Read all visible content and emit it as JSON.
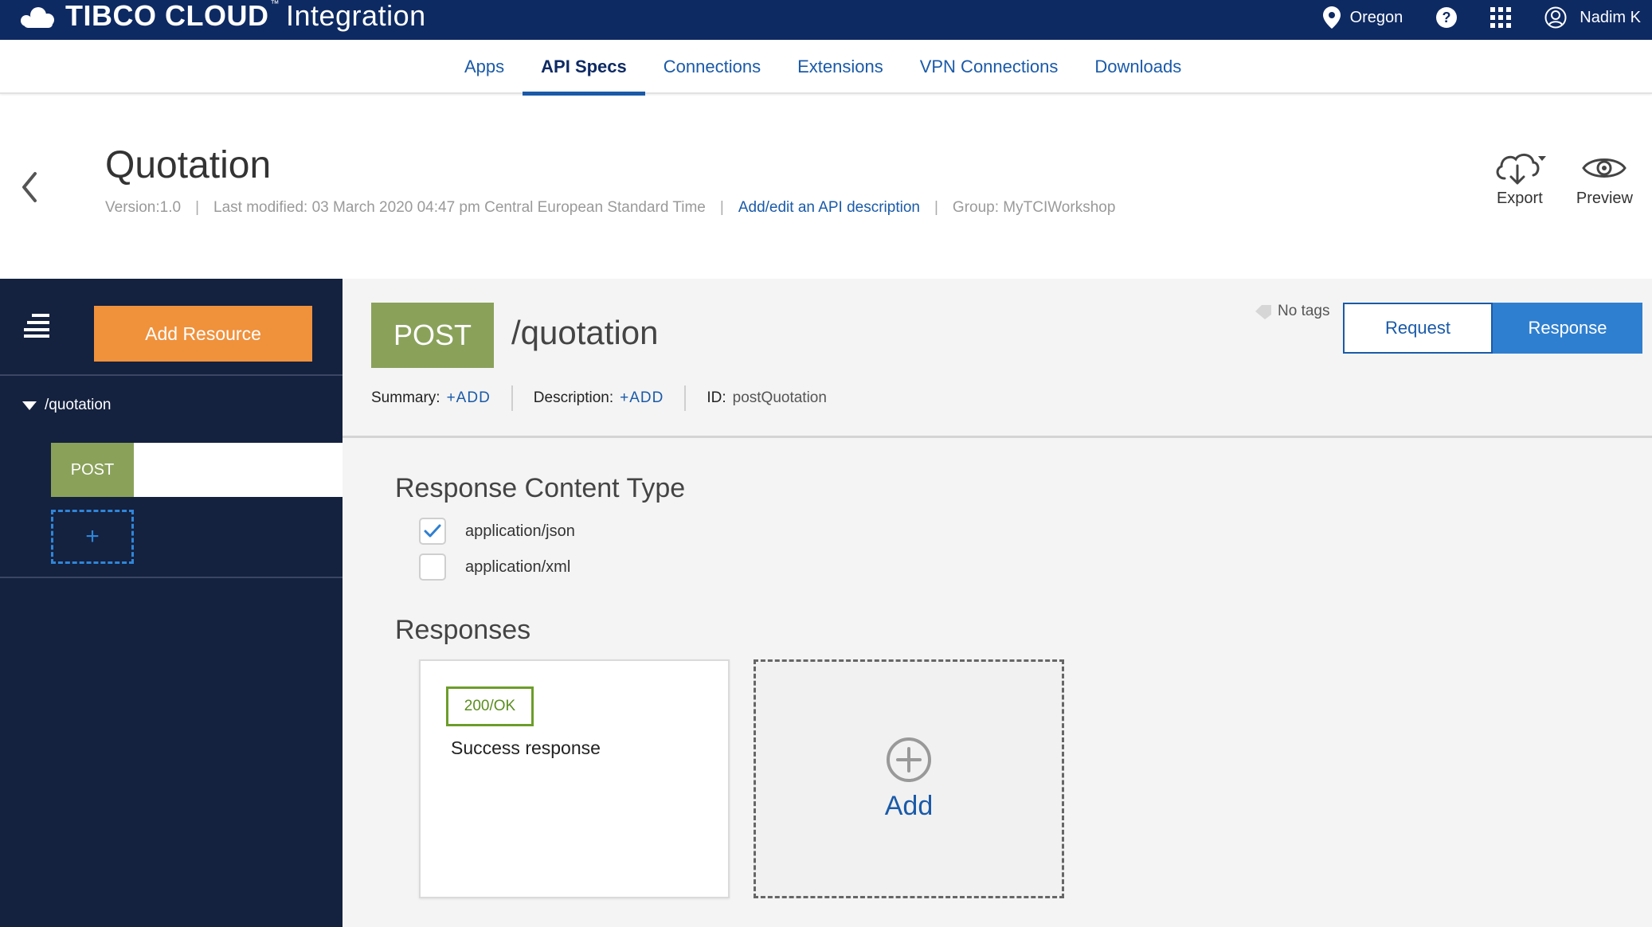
{
  "topbar": {
    "brand_primary": "TIBCO CLOUD",
    "brand_tm": "™",
    "brand_secondary": "Integration",
    "region": "Oregon",
    "user": "Nadim K",
    "icons": [
      "location-pin-icon",
      "help-icon",
      "apps-grid-icon",
      "user-avatar-icon"
    ]
  },
  "nav": {
    "tabs": [
      {
        "label": "Apps",
        "active": false
      },
      {
        "label": "API Specs",
        "active": true
      },
      {
        "label": "Connections",
        "active": false
      },
      {
        "label": "Extensions",
        "active": false
      },
      {
        "label": "VPN Connections",
        "active": false
      },
      {
        "label": "Downloads",
        "active": false
      }
    ]
  },
  "header": {
    "title": "Quotation",
    "version": "Version:1.0",
    "separator": "|",
    "last_modified": "Last modified: 03 March 2020 04:47 pm Central European Standard Time",
    "description_link": "Add/edit an API description",
    "group": "Group: MyTCIWorkshop",
    "export_label": "Export",
    "preview_label": "Preview"
  },
  "sidebar": {
    "add_resource_label": "Add Resource",
    "resource_path": "/quotation",
    "method": "POST",
    "add_method_symbol": "+"
  },
  "operation": {
    "method": "POST",
    "path": "/quotation",
    "tags_text": "No tags",
    "request_label": "Request",
    "response_label": "Response",
    "active_view": "Response",
    "summary_key": "Summary:",
    "summary_action": "+ADD",
    "description_key": "Description:",
    "description_action": "+ADD",
    "id_key": "ID:",
    "id_value": "postQuotation"
  },
  "response_content": {
    "title": "Response Content Type",
    "options": [
      {
        "label": "application/json",
        "checked": true
      },
      {
        "label": "application/xml",
        "checked": false
      }
    ]
  },
  "responses": {
    "title": "Responses",
    "items": [
      {
        "status": "200/OK",
        "description": "Success response"
      }
    ],
    "add_label": "Add"
  },
  "colors": {
    "topbar": "#0e2a63",
    "link": "#1a5aa8",
    "sidebar": "#14213f",
    "add_resource": "#f0913c",
    "post_method": "#8aa15a",
    "response_active": "#2f7fd0",
    "status_ok": "#6c9d2a"
  }
}
